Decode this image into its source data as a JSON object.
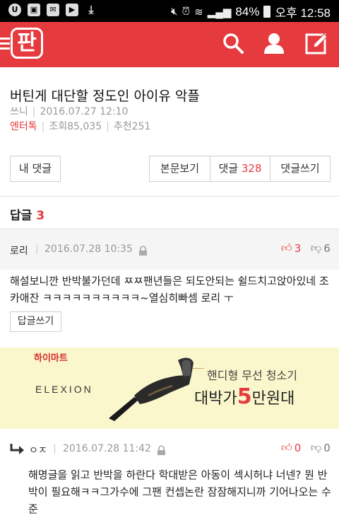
{
  "status_bar": {
    "left_icons": [
      "U",
      "image",
      "mail",
      "youtube",
      "download"
    ],
    "battery": "84%",
    "time": "오후 12:58"
  },
  "header": {
    "logo": "판",
    "icons": [
      "menu-icon",
      "search-icon",
      "user-icon",
      "write-icon"
    ]
  },
  "post": {
    "title": "버틴게 대단할 정도인 아이유 악플",
    "author": "쓰니",
    "date": "2016.07.27 12:10",
    "category": "엔터톡",
    "views": "조회85,035",
    "recommend": "추천251"
  },
  "buttons": {
    "my_comments": "내 댓글",
    "view_post": "본문보기",
    "comments_label": "댓글",
    "comments_count": "328",
    "write_comment": "댓글쓰기"
  },
  "replies": {
    "label": "답글",
    "count": "3"
  },
  "comments": [
    {
      "author": "로리",
      "date": "2016.07.28 10:35",
      "up": "3",
      "down": "6",
      "body": "해설보니깐 반박불가던데 ㅉㅉ팬년들은 되도안되는 쉴드치고앉아있네 조카애잔 ㅋㅋㅋㅋㅋㅋㅋㅋㅋㅋ~열심히빠셈 로리 ㅜ",
      "reply_button": "답글쓰기"
    },
    {
      "author": "ㅇㅈ",
      "date": "2016.07.28 11:42",
      "up": "0",
      "down": "0",
      "body": "해명글을 읽고 반박을 하란다 학대받은 아동이 섹시허냐 너넨? 뭔 반박이 필요해ㅋㅋ그가수에 그팬 컨셉논란 잠잠해지니까 기어나오는 수준"
    }
  ],
  "ad": {
    "brand": "하이마트",
    "product": "ELEXION",
    "subtitle": "핸디형 무선 청소기",
    "headline_pre": "대박가",
    "headline_big": "5",
    "headline_post": "만원대"
  },
  "colors": {
    "brand_red": "#e53a3e",
    "ad_background": "#fbf7cc"
  }
}
